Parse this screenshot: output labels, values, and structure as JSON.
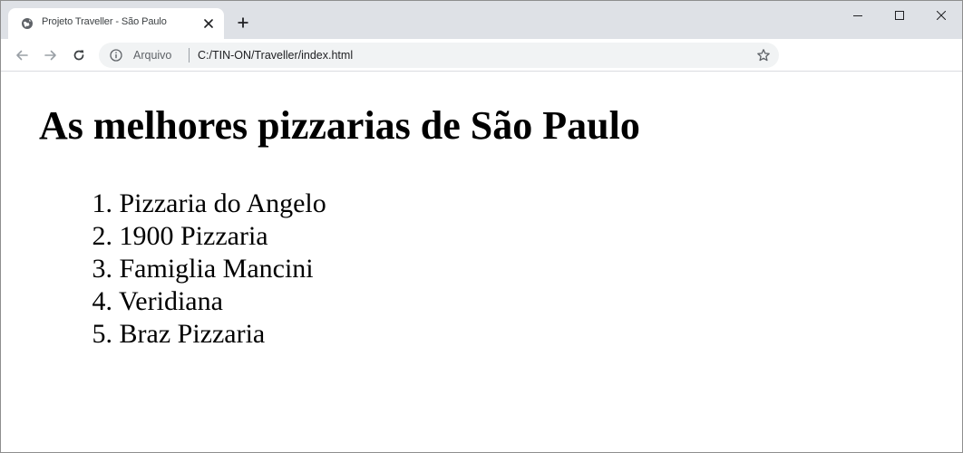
{
  "browser": {
    "tab": {
      "title": "Projeto Traveller - São Paulo",
      "favicon": "globe-icon"
    },
    "window_controls": [
      "minimize-icon",
      "maximize-icon",
      "close-icon"
    ],
    "toolbar": {
      "origin_label": "Arquivo",
      "url": "C:/TIN-ON/Traveller/index.html"
    }
  },
  "page": {
    "heading": "As melhores pizzarias de São Paulo",
    "list": [
      {
        "number": "1.",
        "label": "Pizzaria do Angelo"
      },
      {
        "number": "2.",
        "label": "1900 Pizzaria"
      },
      {
        "number": "3.",
        "label": "Famiglia Mancini"
      },
      {
        "number": "4.",
        "label": "Veridiana"
      },
      {
        "number": "5.",
        "label": "Braz Pizzaria"
      }
    ]
  },
  "colors": {
    "tabstrip_bg": "#dee1e6",
    "omnibox_bg": "#f1f3f4",
    "text": "#000000"
  }
}
